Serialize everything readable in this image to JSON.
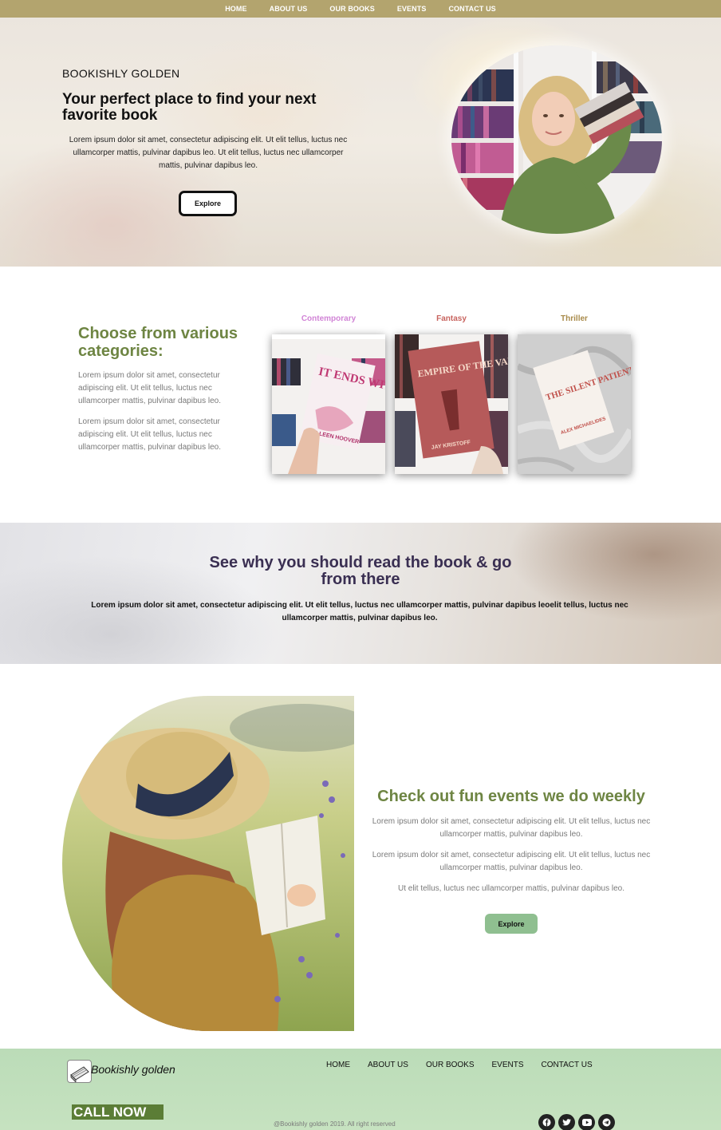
{
  "nav": {
    "items": [
      "HOME",
      "ABOUT US",
      "OUR BOOKS",
      "EVENTS",
      "CONTACT US"
    ]
  },
  "hero": {
    "kicker": "BOOKISHLY GOLDEN",
    "title": "Your perfect place to find your next favorite book",
    "text": "Lorem ipsum dolor sit amet, consectetur adipiscing elit. Ut elit tellus, luctus nec ullamcorper mattis, pulvinar dapibus leo. Ut elit tellus, luctus nec ullamcorper mattis, pulvinar dapibus leo.",
    "button": "Explore"
  },
  "categories": {
    "heading": "Choose from various categories:",
    "para1": "Lorem ipsum dolor sit amet, consectetur adipiscing elit. Ut elit tellus, luctus nec ullamcorper mattis, pulvinar dapibus leo.",
    "para2": "Lorem ipsum dolor sit amet, consectetur adipiscing elit. Ut elit tellus, luctus nec ullamcorper mattis, pulvinar dapibus leo.",
    "items": [
      {
        "label": "Contemporary",
        "color": "#d184d6"
      },
      {
        "label": "Fantasy",
        "color": "#c8645f"
      },
      {
        "label": "Thriller",
        "color": "#a88a4a"
      }
    ],
    "books": [
      {
        "title": "IT ENDS WITH US",
        "author": "COLLEEN HOOVER"
      },
      {
        "title": "EMPIRE OF THE VAMPIRE",
        "author": "JAY KRISTOFF"
      },
      {
        "title": "THE SILENT PATIENT",
        "author": "ALEX MICHAELIDES"
      }
    ]
  },
  "banner": {
    "title": "See why you should read the book & go from there",
    "text": "Lorem ipsum dolor sit amet, consectetur adipiscing elit. Ut elit tellus, luctus nec ullamcorper mattis, pulvinar dapibus leoelit tellus, luctus nec ullamcorper mattis, pulvinar dapibus leo."
  },
  "events": {
    "title": "Check out fun events we do weekly",
    "para1": "Lorem ipsum dolor sit amet, consectetur adipiscing elit. Ut elit tellus, luctus nec ullamcorper mattis, pulvinar dapibus leo.",
    "para2": "Lorem ipsum dolor sit amet, consectetur adipiscing elit. Ut elit tellus, luctus nec ullamcorper mattis, pulvinar dapibus leo.",
    "para3": "Ut elit tellus, luctus nec ullamcorper mattis, pulvinar dapibus leo.",
    "button": "Explore"
  },
  "footer": {
    "brand": "Bookishly golden",
    "nav": [
      "HOME",
      "ABOUT US",
      "OUR BOOKS",
      "EVENTS",
      "CONTACT US"
    ],
    "call": "CALL NOW",
    "copyright": "@Bookishly golden 2019. All right reserved",
    "socials": [
      "facebook-icon",
      "twitter-icon",
      "youtube-icon",
      "telegram-icon"
    ]
  },
  "colors": {
    "nav_bg": "#b3a46e",
    "green_heading": "#6e8543",
    "banner_title": "#3a2f52",
    "footer_bg": "#bbdcb8",
    "button_green": "#8fbf90"
  }
}
